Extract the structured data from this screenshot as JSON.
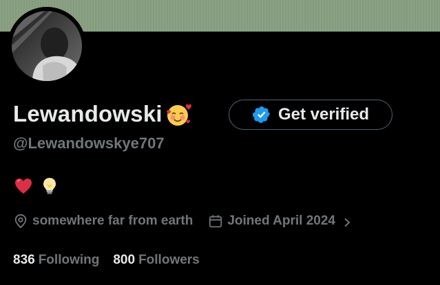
{
  "profile": {
    "display_name": "Lewandowski",
    "name_emoji": "smiling-face-with-hearts",
    "handle": "@Lewandowskye707",
    "bio_emojis": [
      "red-heart",
      "light-bulb"
    ],
    "location": "somewhere far from earth",
    "joined": "Joined April 2024",
    "following_count": "836",
    "following_label": "Following",
    "followers_count": "800",
    "followers_label": "Followers"
  },
  "actions": {
    "get_verified_label": "Get verified"
  },
  "colors": {
    "background": "#000000",
    "banner": "#879e80",
    "primary_text": "#e7e9ea",
    "secondary_text": "#71767b",
    "verified_blue": "#1d9bf0",
    "button_border": "#536471"
  },
  "icons": {
    "location": "location-pin-icon",
    "calendar": "calendar-icon",
    "chevron": "chevron-right-icon",
    "verified": "verified-badge-icon"
  }
}
